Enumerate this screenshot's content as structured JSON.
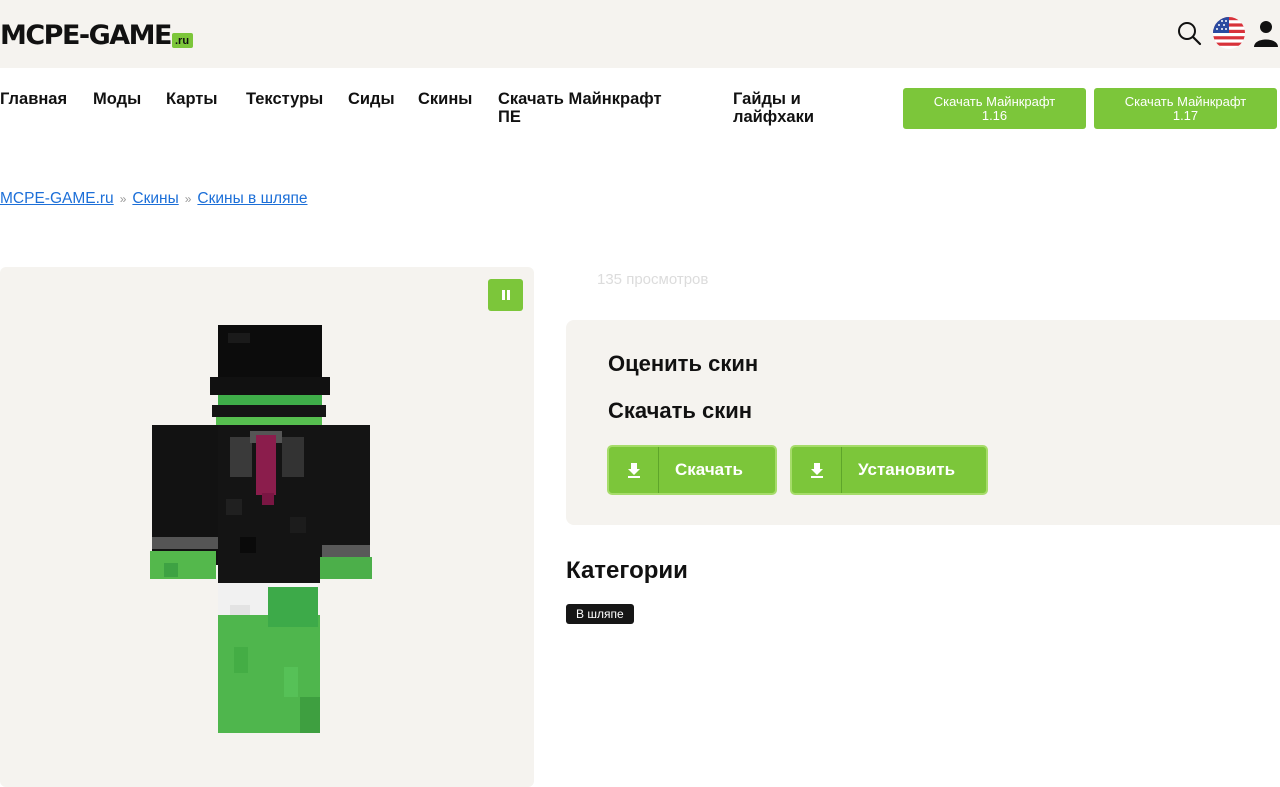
{
  "header": {
    "logo_text": "MCPE-GAME",
    "logo_suffix": ".ru",
    "icons": [
      "search-icon",
      "us-flag-icon",
      "user-icon"
    ]
  },
  "nav": {
    "items": [
      {
        "label": "Главная"
      },
      {
        "label": "Моды"
      },
      {
        "label": "Карты"
      },
      {
        "label": "Текстуры"
      },
      {
        "label": "Сиды"
      },
      {
        "label": "Скины"
      },
      {
        "label_line1": "Скачать Майнкрафт",
        "label_line2": "ПЕ"
      },
      {
        "label_line1": "Гайды и",
        "label_line2": "лайфхаки"
      }
    ],
    "buttons": [
      {
        "line1": "Скачать Майнкрафт",
        "line2": "1.16"
      },
      {
        "line1": "Скачать Майнкрафт",
        "line2": "1.17"
      }
    ]
  },
  "breadcrumb": {
    "items": [
      "MCPE-GAME.ru",
      "Скины",
      "Скины в шляпе"
    ],
    "separator": "»"
  },
  "skin": {
    "views": "135 просмотров"
  },
  "card": {
    "rate_title": "Оценить скин",
    "download_title": "Скачать скин",
    "download_label": "Скачать",
    "install_label": "Установить"
  },
  "categories": {
    "title": "Категории",
    "tags": [
      "В шляпе"
    ]
  },
  "colors": {
    "accent": "#7cc63a",
    "panel_bg": "#f5f3ef",
    "link": "#1c6fd8",
    "tag_bg": "#161616"
  }
}
